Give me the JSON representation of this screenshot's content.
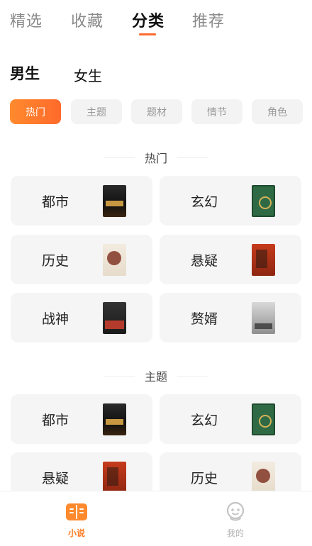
{
  "top_tabs": [
    "精选",
    "收藏",
    "分类",
    "推荐"
  ],
  "gender": [
    "男生",
    "女生"
  ],
  "tags": [
    "热门",
    "主题",
    "题材",
    "情节",
    "角色"
  ],
  "sections": [
    {
      "title": "热门",
      "cards": [
        {
          "label": "都市",
          "cover": "city-cover"
        },
        {
          "label": "玄幻",
          "cover": "fantasy-cover"
        },
        {
          "label": "历史",
          "cover": "history-cover"
        },
        {
          "label": "悬疑",
          "cover": "mystery-cover"
        },
        {
          "label": "战神",
          "cover": "war-god-cover"
        },
        {
          "label": "赘婿",
          "cover": "son-in-law-cover"
        }
      ]
    },
    {
      "title": "主题",
      "cards": [
        {
          "label": "都市",
          "cover": "city-cover"
        },
        {
          "label": "玄幻",
          "cover": "fantasy-cover"
        },
        {
          "label": "悬疑",
          "cover": "mystery-cover"
        },
        {
          "label": "历史",
          "cover": "history-cover"
        }
      ]
    }
  ],
  "bottom_nav": [
    {
      "label": "小说",
      "icon": "book-icon"
    },
    {
      "label": "我的",
      "icon": "profile-icon"
    }
  ],
  "colors": {
    "accent": "#ff6a2b",
    "tab_active_text": "#ffffff",
    "card_bg": "#f5f5f5"
  }
}
